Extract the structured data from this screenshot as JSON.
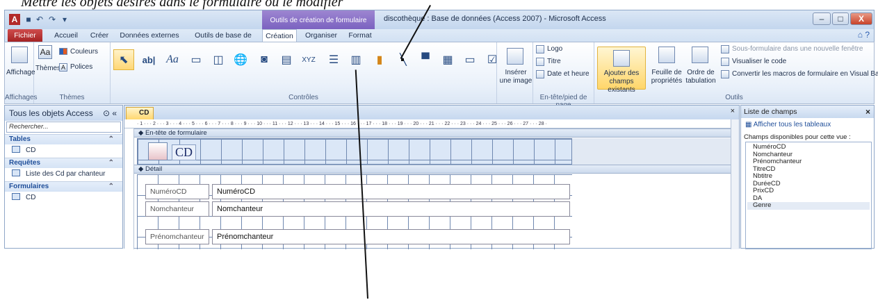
{
  "caption": "Mettre les objets désirés dans le formulaire ou le modifier",
  "titlebar": {
    "app_logo": "A",
    "context_tab": "Outils de création de formulaire",
    "window_title": "discothèque : Base de données (Access 2007) - Microsoft Access",
    "minimize": "–",
    "maximize": "□",
    "close": "X"
  },
  "tabs": [
    "Fichier",
    "Accueil",
    "Créer",
    "Données externes",
    "Outils de base de données",
    "Création",
    "Organiser",
    "Format"
  ],
  "ribbon": {
    "view": {
      "label": "Affichage",
      "group": "Affichages"
    },
    "themes": {
      "themes": "Thèmes",
      "colors": "Couleurs",
      "fonts": "Polices",
      "group": "Thèmes"
    },
    "controls_group": "Contrôles",
    "insert_image": "Insérer une image",
    "header_footer": {
      "logo": "Logo",
      "title": "Titre",
      "datetime": "Date et heure",
      "group": "En-tête/pied de page"
    },
    "tools": {
      "add_fields": "Ajouter des champs existants",
      "property_sheet": "Feuille de propriétés",
      "tab_order": "Ordre de tabulation",
      "subform": "Sous-formulaire dans une nouvelle fenêtre",
      "view_code": "Visualiser le code",
      "convert_macros": "Convertir les macros de formulaire en Visual Basic",
      "group": "Outils"
    }
  },
  "nav": {
    "header": "Tous les objets Access",
    "search_placeholder": "Rechercher...",
    "groups": [
      {
        "name": "Tables",
        "items": [
          "CD"
        ]
      },
      {
        "name": "Requêtes",
        "items": [
          "Liste des Cd par chanteur"
        ]
      },
      {
        "name": "Formulaires",
        "items": [
          "CD"
        ]
      }
    ]
  },
  "doc": {
    "tab": "CD",
    "header_section": "En-tête de formulaire",
    "detail_section": "Détail",
    "form_title": "CD",
    "fields": [
      {
        "label": "NuméroCD",
        "value": "NuméroCD"
      },
      {
        "label": "Nomchanteur",
        "value": "Nomchanteur"
      },
      {
        "label": "Prénomchanteur",
        "value": "Prénomchanteur"
      }
    ],
    "ruler": "· 1 · · · 2 · · · 3 · · · 4 · · · 5 · · · 6 · · · 7 · · · 8 · · · 9 · · · 10 · · · 11 · · · 12 · · · 13 · · · 14 · · · 15 · · · 16 · · · 17 · · · 18 · · · 19 · · · 20 · · · 21 · · · 22 · · · 23 · · · 24 · · · 25 · · · 26 · · · 27 · · · 28 ·"
  },
  "fieldlist": {
    "header": "Liste de champs",
    "show_all": "Afficher tous les tableaux",
    "caption": "Champs disponibles pour cette vue :",
    "fields": [
      "NuméroCD",
      "Nomchanteur",
      "Prénomchanteur",
      "TitreCD",
      "Nbtitre",
      "DuréeCD",
      "PrixCD",
      "DA",
      "Genre"
    ]
  }
}
